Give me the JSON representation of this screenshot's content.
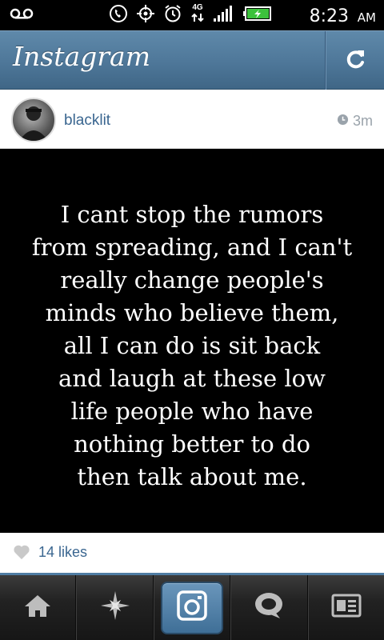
{
  "status_bar": {
    "network_label": "4G",
    "time": "8:23",
    "ampm": "AM"
  },
  "header": {
    "title": "Instagram",
    "refresh_icon": "refresh-icon"
  },
  "post": {
    "username": "blacklit",
    "timestamp": "3m",
    "quote": "I cant stop the rumors\nfrom spreading, and I can't\nreally change people's\nminds who believe them,\nall I can do is sit back\nand laugh at these low\nlife people who have\nnothing better to do\nthen talk about me.",
    "likes": "14 likes"
  },
  "tabs": [
    {
      "icon": "home-icon"
    },
    {
      "icon": "explore-star-icon"
    },
    {
      "icon": "camera-icon"
    },
    {
      "icon": "news-speech-bubble-icon"
    },
    {
      "icon": "profile-card-icon"
    }
  ],
  "colors": {
    "header_blue": "#4e7799",
    "link_blue": "#3a6690",
    "tab_accent": "#4f7da3"
  }
}
